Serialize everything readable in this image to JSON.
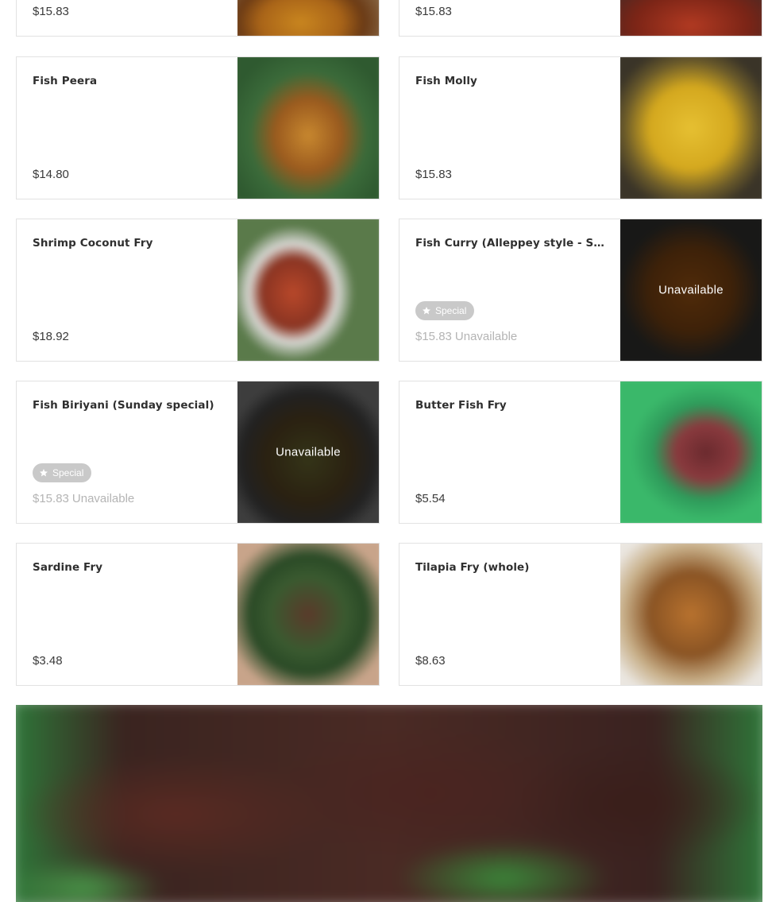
{
  "colors": {
    "card_border": "#e2e2e2",
    "text_primary": "#2f2f2f",
    "text_muted": "#b4b4b4",
    "badge_bg": "#c9c9c9",
    "unavailable_overlay": "rgba(0,0,0,0.42)"
  },
  "menu_items": [
    {
      "name": "",
      "price": "$15.83",
      "available": true,
      "special": false,
      "image_icon": "biryani-dish-photo"
    },
    {
      "name": "",
      "price": "$15.83",
      "available": true,
      "special": false,
      "image_icon": "red-curry-dish-photo"
    },
    {
      "name": "Fish Peera",
      "price": "$14.80",
      "available": true,
      "special": false,
      "image_icon": "fish-peera-photo"
    },
    {
      "name": "Fish Molly",
      "price": "$15.83",
      "available": true,
      "special": false,
      "image_icon": "fish-molly-photo"
    },
    {
      "name": "Shrimp Coconut Fry",
      "price": "$18.92",
      "available": true,
      "special": false,
      "image_icon": "shrimp-coconut-fry-photo"
    },
    {
      "name": "Fish Curry (Alleppey style - Sunday special)",
      "price": "$15.83",
      "available": false,
      "special": true,
      "badge_label": "Special",
      "unavailable_label": "Unavailable",
      "image_unavailable_label": "Unavailable",
      "image_icon": "fish-curry-photo"
    },
    {
      "name": "Fish Biriyani (Sunday special)",
      "price": "$15.83",
      "available": false,
      "special": true,
      "badge_label": "Special",
      "unavailable_label": "Unavailable",
      "image_unavailable_label": "Unavailable",
      "image_icon": "fish-biriyani-photo"
    },
    {
      "name": "Butter Fish Fry",
      "price": "$5.54",
      "available": true,
      "special": false,
      "image_icon": "butter-fish-fry-photo"
    },
    {
      "name": "Sardine Fry",
      "price": "$3.48",
      "available": true,
      "special": false,
      "image_icon": "sardine-fry-photo"
    },
    {
      "name": "Tilapia Fry (whole)",
      "price": "$8.63",
      "available": true,
      "special": false,
      "image_icon": "tilapia-fry-photo"
    }
  ],
  "banner": {
    "image_icon": "fried-fish-banner-photo"
  }
}
